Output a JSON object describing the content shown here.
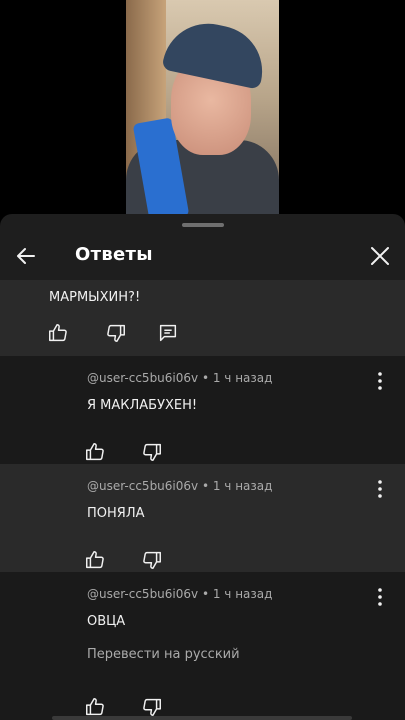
{
  "header": {
    "title": "Ответы"
  },
  "parent_comment": {
    "text": "МАРМЫХИН?!"
  },
  "replies": [
    {
      "author": "@user-cc5bu6i06v",
      "time": "1 ч назад",
      "text": "Я МАКЛАБУХЕН!"
    },
    {
      "author": "@user-cc5bu6i06v",
      "time": "1 ч назад",
      "text": "ПОНЯЛА"
    },
    {
      "author": "@user-cc5bu6i06v",
      "time": "1 ч назад",
      "text": "ОВЦА",
      "translate_label": "Перевести на русский"
    }
  ],
  "colors": {
    "sheet_bg": "#1e1e1e",
    "highlight_bg": "#2a2a2a",
    "text_primary": "#f1f1f1",
    "text_secondary": "#aaaaaa"
  },
  "icons": [
    "back-arrow-icon",
    "close-icon",
    "thumbs-up-icon",
    "thumbs-down-icon",
    "reply-icon",
    "more-vert-icon"
  ]
}
